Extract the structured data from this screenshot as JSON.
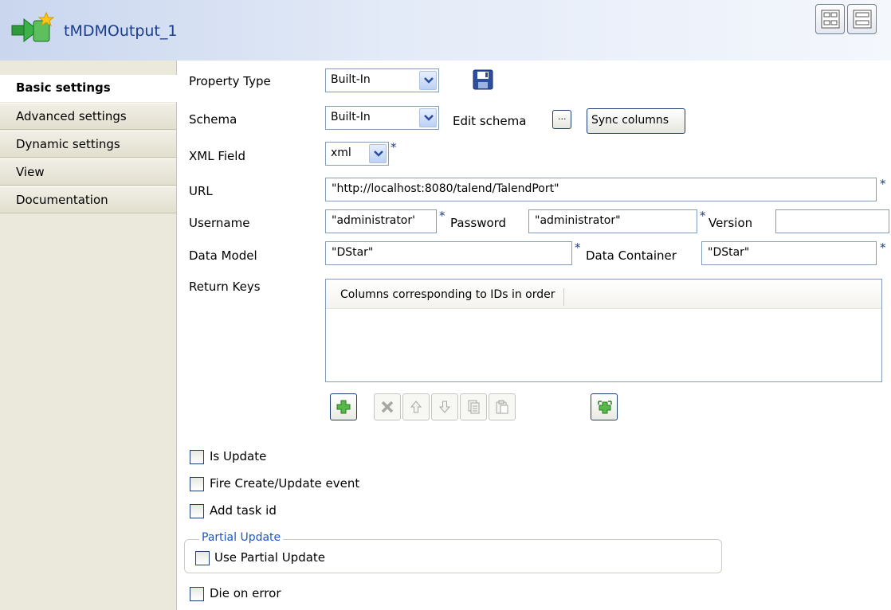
{
  "header": {
    "component_title": "tMDMOutput_1",
    "icons": [
      "component-arrow-icon",
      "horizontal-layout-icon",
      "vertical-layout-icon"
    ]
  },
  "sidebar": {
    "tabs": [
      {
        "label": "Basic settings",
        "active": true
      },
      {
        "label": "Advanced settings",
        "active": false
      },
      {
        "label": "Dynamic settings",
        "active": false
      },
      {
        "label": "View",
        "active": false
      },
      {
        "label": "Documentation",
        "active": false
      }
    ]
  },
  "form": {
    "property_type": {
      "label": "Property Type",
      "value": "Built-In"
    },
    "schema": {
      "label": "Schema",
      "value": "Built-In",
      "edit_label": "Edit schema",
      "edit_button": "...",
      "sync_button": "Sync columns"
    },
    "xml_field": {
      "label": "XML Field",
      "value": "xml"
    },
    "url": {
      "label": "URL",
      "value": "\"http://localhost:8080/talend/TalendPort\""
    },
    "username": {
      "label": "Username",
      "value": "\"administrator'"
    },
    "password": {
      "label": "Password",
      "value": "\"administrator\""
    },
    "version": {
      "label": "Version",
      "value": ""
    },
    "data_model": {
      "label": "Data Model",
      "value": "\"DStar\""
    },
    "data_container": {
      "label": "Data Container",
      "value": "\"DStar\""
    },
    "return_keys": {
      "label": "Return Keys",
      "column_header": "Columns corresponding to IDs in order",
      "rows": []
    },
    "required_mark": "*",
    "checkboxes": {
      "is_update": {
        "label": "Is Update",
        "checked": false
      },
      "fire_event": {
        "label": "Fire Create/Update event",
        "checked": false
      },
      "add_task_id": {
        "label": "Add task id",
        "checked": false
      },
      "use_partial_update": {
        "label": "Use Partial Update",
        "checked": false
      },
      "die_on_error": {
        "label": "Die on error",
        "checked": false
      }
    },
    "partial_update_group": "Partial Update"
  },
  "colors": {
    "accent": "#1a3e8c",
    "group_title": "#1a57c8",
    "sidebar_bg": "#ebe9dc"
  }
}
